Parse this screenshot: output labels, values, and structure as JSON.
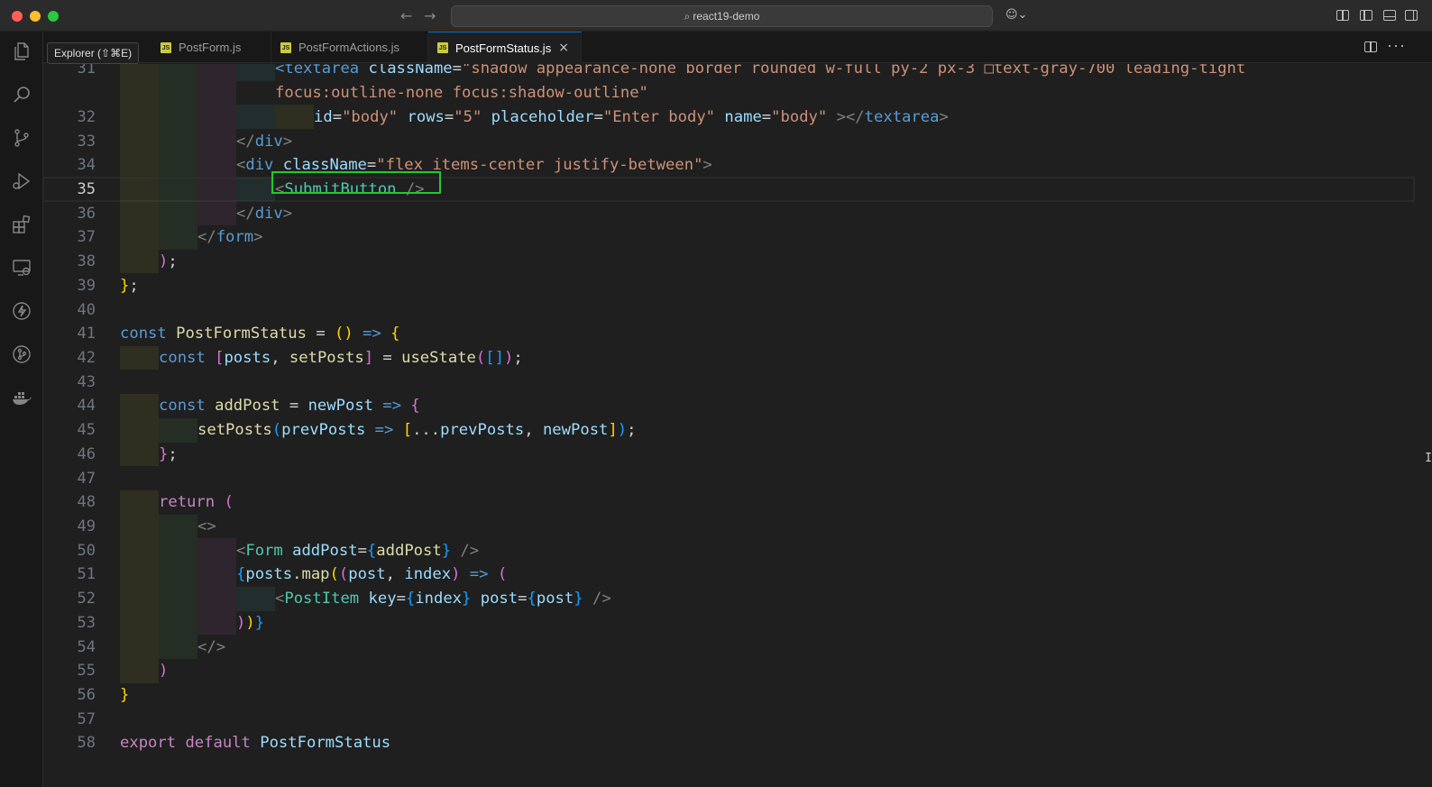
{
  "window": {
    "search_text": "react19-demo"
  },
  "tooltip": {
    "text": "Explorer (⇧⌘E)"
  },
  "tabs": [
    {
      "label": "PostForm.js",
      "icon": "js-file-icon",
      "badge": "JS"
    },
    {
      "label": "PostFormActions.js",
      "icon": "js-file-icon",
      "badge": "JS"
    },
    {
      "label": "PostFormStatus.js",
      "icon": "js-file-icon",
      "badge": "JS",
      "active": true
    }
  ],
  "activity_bar": [
    "explorer-icon",
    "search-icon",
    "source-control-icon",
    "run-debug-icon",
    "extensions-icon",
    "remote-explorer-icon",
    "lightning-icon",
    "git-graph-icon",
    "docker-icon"
  ],
  "editor": {
    "current_line": "35",
    "lines": [
      {
        "n": "31",
        "t": "<textarea className=\"shadow appearance-none border rounded w-full py-2 px-3 □text-gray-700 leading-tight"
      },
      {
        "n": "",
        "t": "focus:outline-none focus:shadow-outline\""
      },
      {
        "n": "32",
        "t": "id=\"body\" rows=\"5\" placeholder=\"Enter body\" name=\"body\" ></textarea>"
      },
      {
        "n": "33",
        "t": "</div>"
      },
      {
        "n": "34",
        "t": "<div className=\"flex items-center justify-between\">"
      },
      {
        "n": "35",
        "t": "<SubmitButton />"
      },
      {
        "n": "36",
        "t": "</div>"
      },
      {
        "n": "37",
        "t": "</form>"
      },
      {
        "n": "38",
        "t": ");"
      },
      {
        "n": "39",
        "t": "};"
      },
      {
        "n": "40",
        "t": ""
      },
      {
        "n": "41",
        "t": "const PostFormStatus = () => {"
      },
      {
        "n": "42",
        "t": "const [posts, setPosts] = useState([]);"
      },
      {
        "n": "43",
        "t": ""
      },
      {
        "n": "44",
        "t": "const addPost = newPost => {"
      },
      {
        "n": "45",
        "t": "setPosts(prevPosts => [...prevPosts, newPost]);"
      },
      {
        "n": "46",
        "t": "};"
      },
      {
        "n": "47",
        "t": ""
      },
      {
        "n": "48",
        "t": "return ("
      },
      {
        "n": "49",
        "t": "<>"
      },
      {
        "n": "50",
        "t": "<Form addPost={addPost} />"
      },
      {
        "n": "51",
        "t": "{posts.map((post, index) => ("
      },
      {
        "n": "52",
        "t": "<PostItem key={index} post={post} />"
      },
      {
        "n": "53",
        "t": "))}"
      },
      {
        "n": "54",
        "t": "</>"
      },
      {
        "n": "55",
        "t": ")"
      },
      {
        "n": "56",
        "t": "}"
      },
      {
        "n": "57",
        "t": ""
      },
      {
        "n": "58",
        "t": "export default PostFormStatus"
      }
    ]
  }
}
